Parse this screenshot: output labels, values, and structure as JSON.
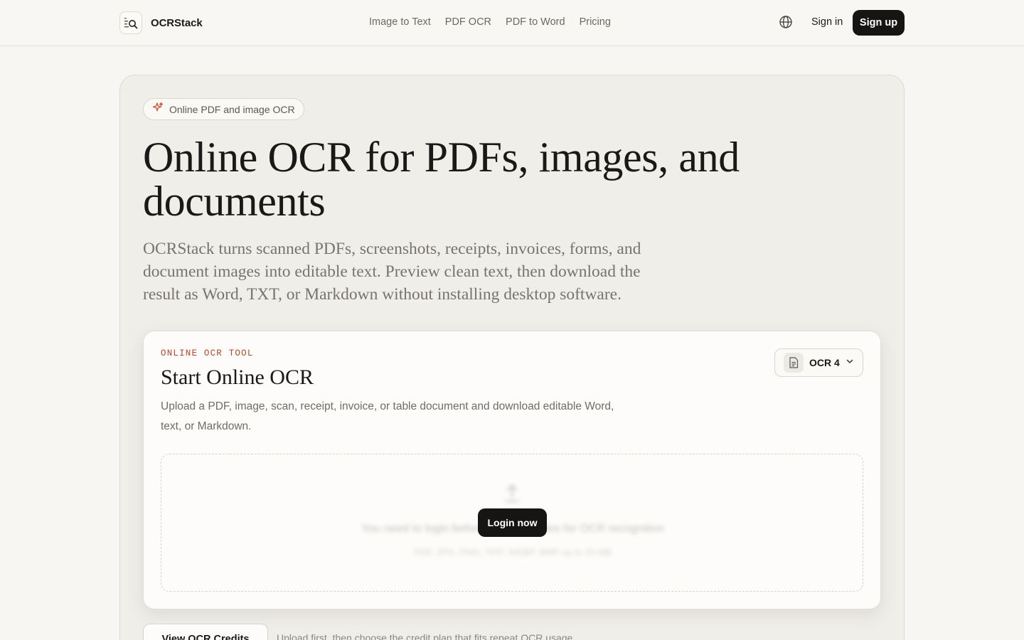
{
  "header": {
    "brand_name": "OCRStack",
    "nav": [
      "Image to Text",
      "PDF OCR",
      "PDF to Word",
      "Pricing"
    ],
    "sign_in": "Sign in",
    "sign_up": "Sign up"
  },
  "hero": {
    "chip_label": "Online PDF and image OCR",
    "headline": "Online OCR for PDFs, images, and documents",
    "lede": "OCRStack turns scanned PDFs, screenshots, receipts, invoices, forms, and document images into editable text. Preview clean text, then download the result as Word, TXT, or Markdown without installing desktop software."
  },
  "tool": {
    "eyebrow": "ONLINE OCR TOOL",
    "title": "Start Online OCR",
    "description": "Upload a PDF, image, scan, receipt, invoice, or table document and download editable Word, text, or Markdown.",
    "model_label": "OCR 4",
    "dropzone_text": "You need to login before uploading files for OCR recognition",
    "dropzone_hint": "PDF, JPG, PNG, TIFF, WEBP, BMP up to 20 MB",
    "login_button": "Login now"
  },
  "footer_row": {
    "credits_button": "View OCR Credits",
    "credits_note": "Upload first, then choose the credit plan that fits repeat OCR usage."
  },
  "colors": {
    "accent": "#b4472d",
    "primary_button": "#161513",
    "background": "#f7f6f2"
  },
  "icons": [
    "logo-icon",
    "globe-icon",
    "sparkle-icon",
    "document-icon",
    "chevron-down-icon",
    "upload-icon"
  ]
}
